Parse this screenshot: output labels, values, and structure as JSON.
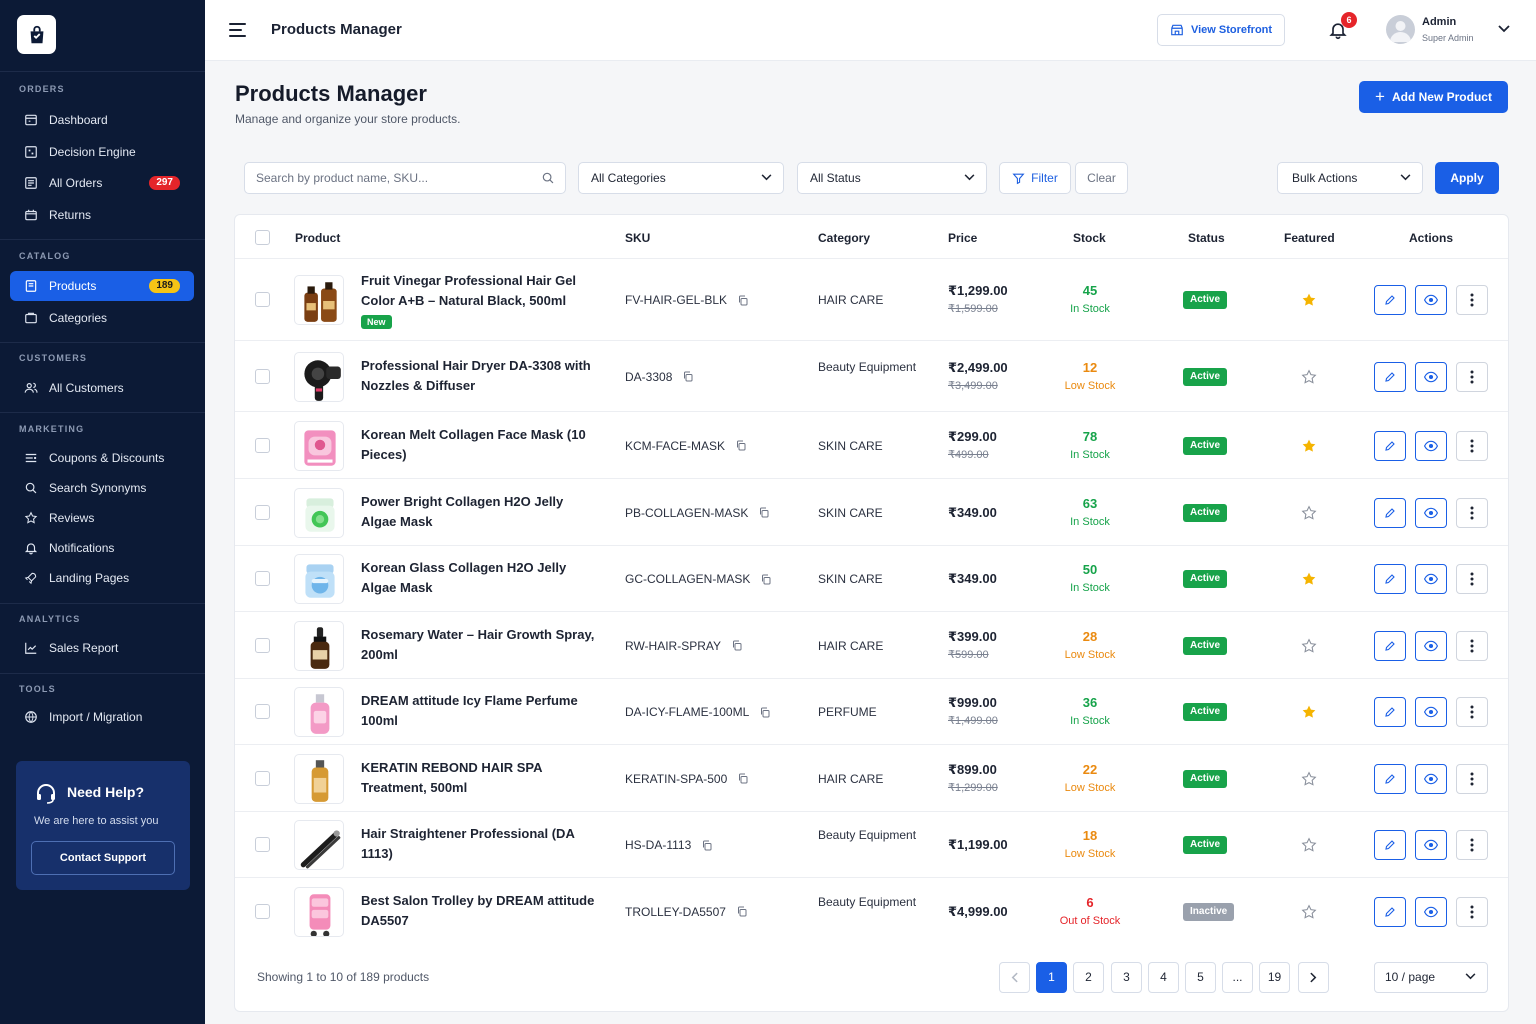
{
  "sidebar": {
    "sections": [
      {
        "heading": "ORDERS",
        "items": [
          {
            "label": "Dashboard",
            "icon": "dashboard-icon"
          },
          {
            "label": "Decision Engine",
            "icon": "decision-engine-icon"
          },
          {
            "label": "All Orders",
            "icon": "orders-icon",
            "badge": "297"
          },
          {
            "label": "Returns",
            "icon": "returns-icon"
          }
        ]
      },
      {
        "heading": "CATALOG",
        "items": [
          {
            "label": "Products",
            "icon": "products-icon",
            "badge": "189",
            "active": true
          },
          {
            "label": "Categories",
            "icon": "categories-icon"
          }
        ]
      },
      {
        "heading": "CUSTOMERS",
        "items": [
          {
            "label": "All Customers",
            "icon": "customers-icon"
          }
        ]
      },
      {
        "heading": "MARKETING",
        "items": [
          {
            "label": "Coupons & Discounts",
            "icon": "coupon-icon"
          },
          {
            "label": "Search Synonyms",
            "icon": "search-icon"
          },
          {
            "label": "Reviews",
            "icon": "star-icon"
          },
          {
            "label": "Notifications",
            "icon": "bell-icon"
          },
          {
            "label": "Landing Pages",
            "icon": "rocket-icon"
          }
        ]
      },
      {
        "heading": "ANALYTICS",
        "items": [
          {
            "label": "Sales Report",
            "icon": "chart-icon"
          }
        ]
      },
      {
        "heading": "TOOLS",
        "items": [
          {
            "label": "Import / Migration",
            "icon": "import-icon"
          }
        ]
      }
    ],
    "help": {
      "title": "Need Help?",
      "subtitle": "We are here to assist you",
      "button": "Contact Support"
    }
  },
  "header": {
    "title": "Products Manager",
    "storefront_label": "View Storefront",
    "notification_count": "6",
    "user_name": "Admin",
    "user_role": "Super Admin"
  },
  "page": {
    "title": "Products Manager",
    "subtitle": "Manage and organize your store products.",
    "add_label": "Add New Product"
  },
  "filters": {
    "search_placeholder": "Search by product name, SKU...",
    "category": "All Categories",
    "status": "All Status",
    "filter_label": "Filter",
    "clear_label": "Clear",
    "bulk_label": "Bulk Actions",
    "apply_label": "Apply"
  },
  "table": {
    "columns": [
      "Product",
      "SKU",
      "Category",
      "Price",
      "Stock",
      "Status",
      "Featured",
      "Actions"
    ],
    "rows": [
      {
        "name": "Fruit Vinegar Professional Hair Gel Color A+B – Natural Black, 500ml",
        "badge": "New",
        "sku": "FV-HAIR-GEL-BLK",
        "category": "HAIR CARE",
        "price": "₹1,299.00",
        "old_price": "₹1,599.00",
        "stock": "45",
        "stock_label": "In Stock",
        "stock_color": "#16a34a",
        "status": "Active",
        "featured": true,
        "thumb": "bottles"
      },
      {
        "name": "Professional Hair Dryer DA-3308 with Nozzles & Diffuser",
        "sku": "DA-3308",
        "category": "Beauty Equipment",
        "price": "₹2,499.00",
        "old_price": "₹3,499.00",
        "stock": "12",
        "stock_label": "Low Stock",
        "stock_color": "#ea8a10",
        "status": "Active",
        "featured": false,
        "thumb": "dryer"
      },
      {
        "name": "Korean Melt Collagen Face Mask (10 Pieces)",
        "sku": "KCM-FACE-MASK",
        "category": "SKIN CARE",
        "price": "₹299.00",
        "old_price": "₹499.00",
        "stock": "78",
        "stock_label": "In Stock",
        "stock_color": "#16a34a",
        "status": "Active",
        "featured": true,
        "thumb": "mask"
      },
      {
        "name": "Power Bright Collagen H2O Jelly Algae Mask",
        "sku": "PB-COLLAGEN-MASK",
        "category": "SKIN CARE",
        "price": "₹349.00",
        "old_price": "",
        "stock": "63",
        "stock_label": "In Stock",
        "stock_color": "#16a34a",
        "status": "Active",
        "featured": false,
        "thumb": "jar-green"
      },
      {
        "name": "Korean Glass Collagen H2O Jelly Algae Mask",
        "sku": "GC-COLLAGEN-MASK",
        "category": "SKIN CARE",
        "price": "₹349.00",
        "old_price": "",
        "stock": "50",
        "stock_label": "In Stock",
        "stock_color": "#16a34a",
        "status": "Active",
        "featured": true,
        "thumb": "jar-blue"
      },
      {
        "name": "Rosemary Water – Hair Growth Spray, 200ml",
        "sku": "RW-HAIR-SPRAY",
        "category": "HAIR CARE",
        "price": "₹399.00",
        "old_price": "₹599.00",
        "stock": "28",
        "stock_label": "Low Stock",
        "stock_color": "#ea8a10",
        "status": "Active",
        "featured": false,
        "thumb": "dropper"
      },
      {
        "name": "DREAM attitude Icy Flame Perfume 100ml",
        "sku": "DA-ICY-FLAME-100ML",
        "category": "PERFUME",
        "price": "₹999.00",
        "old_price": "₹1,499.00",
        "stock": "36",
        "stock_label": "In Stock",
        "stock_color": "#16a34a",
        "status": "Active",
        "featured": true,
        "thumb": "perfume"
      },
      {
        "name": "KERATIN REBOND HAIR SPA Treatment, 500ml",
        "sku": "KERATIN-SPA-500",
        "category": "HAIR CARE",
        "price": "₹899.00",
        "old_price": "₹1,299.00",
        "stock": "22",
        "stock_label": "Low Stock",
        "stock_color": "#ea8a10",
        "status": "Active",
        "featured": false,
        "thumb": "gold-bottle"
      },
      {
        "name": "Hair Straightener Professional (DA 1113)",
        "sku": "HS-DA-1113",
        "category": "Beauty Equipment",
        "price": "₹1,199.00",
        "old_price": "",
        "stock": "18",
        "stock_label": "Low Stock",
        "stock_color": "#ea8a10",
        "status": "Active",
        "featured": false,
        "thumb": "straightener"
      },
      {
        "name": "Best Salon Trolley by DREAM attitude DA5507",
        "sku": "TROLLEY-DA5507",
        "category": "Beauty Equipment",
        "price": "₹4,999.00",
        "old_price": "",
        "stock": "6",
        "stock_label": "Out of Stock",
        "stock_color": "#e5252a",
        "status": "Inactive",
        "featured": false,
        "thumb": "trolley"
      }
    ]
  },
  "footer": {
    "showing": "Showing 1 to 10 of 189 products",
    "pages": [
      "1",
      "2",
      "3",
      "4",
      "5",
      "...",
      "19"
    ],
    "current_page": "1",
    "per_page": "10 / page"
  },
  "colors": {
    "primary": "#1a5fe6",
    "sidebar_bg": "#0c1a36",
    "active_status": "#18a34a",
    "inactive_status": "#9aa1ad",
    "star": "#f5b400"
  }
}
